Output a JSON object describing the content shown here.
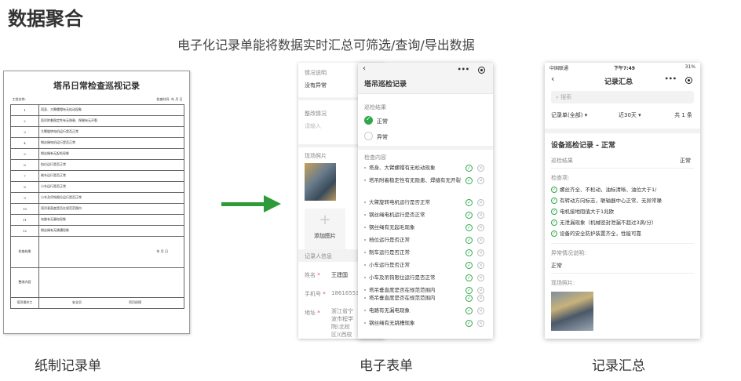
{
  "header": {
    "title": "数据聚合",
    "subtitle": "电子化记录单能将数据实时汇总可筛选/查询/导出数据"
  },
  "captions": {
    "paper": "纸制记录单",
    "electronic": "电子表单",
    "summary": "记录汇总"
  },
  "paper_form": {
    "title": "塔吊日常检查巡视记录",
    "header_left": "工程名称:",
    "header_right": "检查时间:    年    月    日",
    "rows": [
      {
        "num": "1",
        "text": "塔身、大臂螺帽有无松动现象"
      },
      {
        "num": "2",
        "text": "塔吊附着稳定性有无隐患、焊缝有无开裂"
      },
      {
        "num": "3",
        "text": "大臂旋转电机运行是否正常"
      },
      {
        "num": "4",
        "text": "钢丝绳电机运行是否正常"
      },
      {
        "num": "5",
        "text": "钢丝绳有无起毛现象"
      },
      {
        "num": "6",
        "text": "档位运行是否正常"
      },
      {
        "num": "7",
        "text": "制车运行是否正常"
      },
      {
        "num": "8",
        "text": "小车运行是否正常"
      },
      {
        "num": "9",
        "text": "小车及吊钩限位运行是否正常"
      },
      {
        "num": "10",
        "text": "塔吊垂直度是否在规范范围内"
      },
      {
        "num": "11",
        "text": "电路有无漏电现象"
      },
      {
        "num": "12",
        "text": "钢丝绳有无跳槽现象"
      }
    ],
    "result_label": "检查结果",
    "result_date": "年    月    日",
    "rectify_label": "整改内容",
    "footer": [
      "塔吊操作工",
      "安全员",
      "项目经理"
    ]
  },
  "back_form": {
    "situation_label": "情况说明",
    "situation_value": "没有异常",
    "rectify_label": "整改情况",
    "rectify_placeholder": "请输入",
    "photo_label": "现场照片",
    "add_photo": "添加图片",
    "recorder_label": "记录人信息",
    "name_label": "姓名",
    "name_value": "王建国",
    "phone_label": "手机号",
    "phone_value": "18616553",
    "address_label": "地址",
    "address_value": "浙江省宁波市程学院(北校区)(西校区)等"
  },
  "phone": {
    "title": "塔吊巡检记录",
    "back_icon": "chevron-left-icon",
    "result_label": "巡检结果",
    "option_normal": "正常",
    "option_abnormal": "异常",
    "check_label": "检查内容",
    "items": [
      "塔身、大臂螺帽有无松动现象",
      "塔吊附着稳定性有无隐患、焊缝有无开裂",
      "大臂旋转电机运行是否正常",
      "钢丝绳电机运行是否正常",
      "钢丝绳有无起毛现象",
      "档位运行是否正常",
      "制车运行是否正常",
      "小车运行是否正常",
      "小车及吊钩限位运行是否正常",
      "塔吊垂直度是否在规范范围内",
      "塔吊垂直度是否在规范范围内",
      "电路有无漏电现象",
      "钢丝绳有无跳槽现象"
    ]
  },
  "summary": {
    "status_carrier": "中国联通",
    "status_time": "下午7:49",
    "status_battery": "31%",
    "title": "记录汇总",
    "search_placeholder": "搜索",
    "filter_form": "记录单(全部)",
    "filter_range": "近30天",
    "filter_count": "共 1 条",
    "card_title": "设备巡检记录 - 正常",
    "result_label": "巡检结果",
    "result_value": "正常",
    "check_label": "检查项:",
    "checks": [
      "螺丝齐全、不松动，油标清晰、油位大于1/",
      "有转动方向标志，联轴器中心正常、无异常噪",
      "电机接地阻值大于1兆欧",
      "无泄漏现象（机械密封泄漏不超过3滴/分）",
      "设备的安全防护装置齐全，性能可靠"
    ],
    "abnormal_label": "异常情况说明:",
    "abnormal_value": "正常",
    "photo_label": "现场照片:"
  }
}
